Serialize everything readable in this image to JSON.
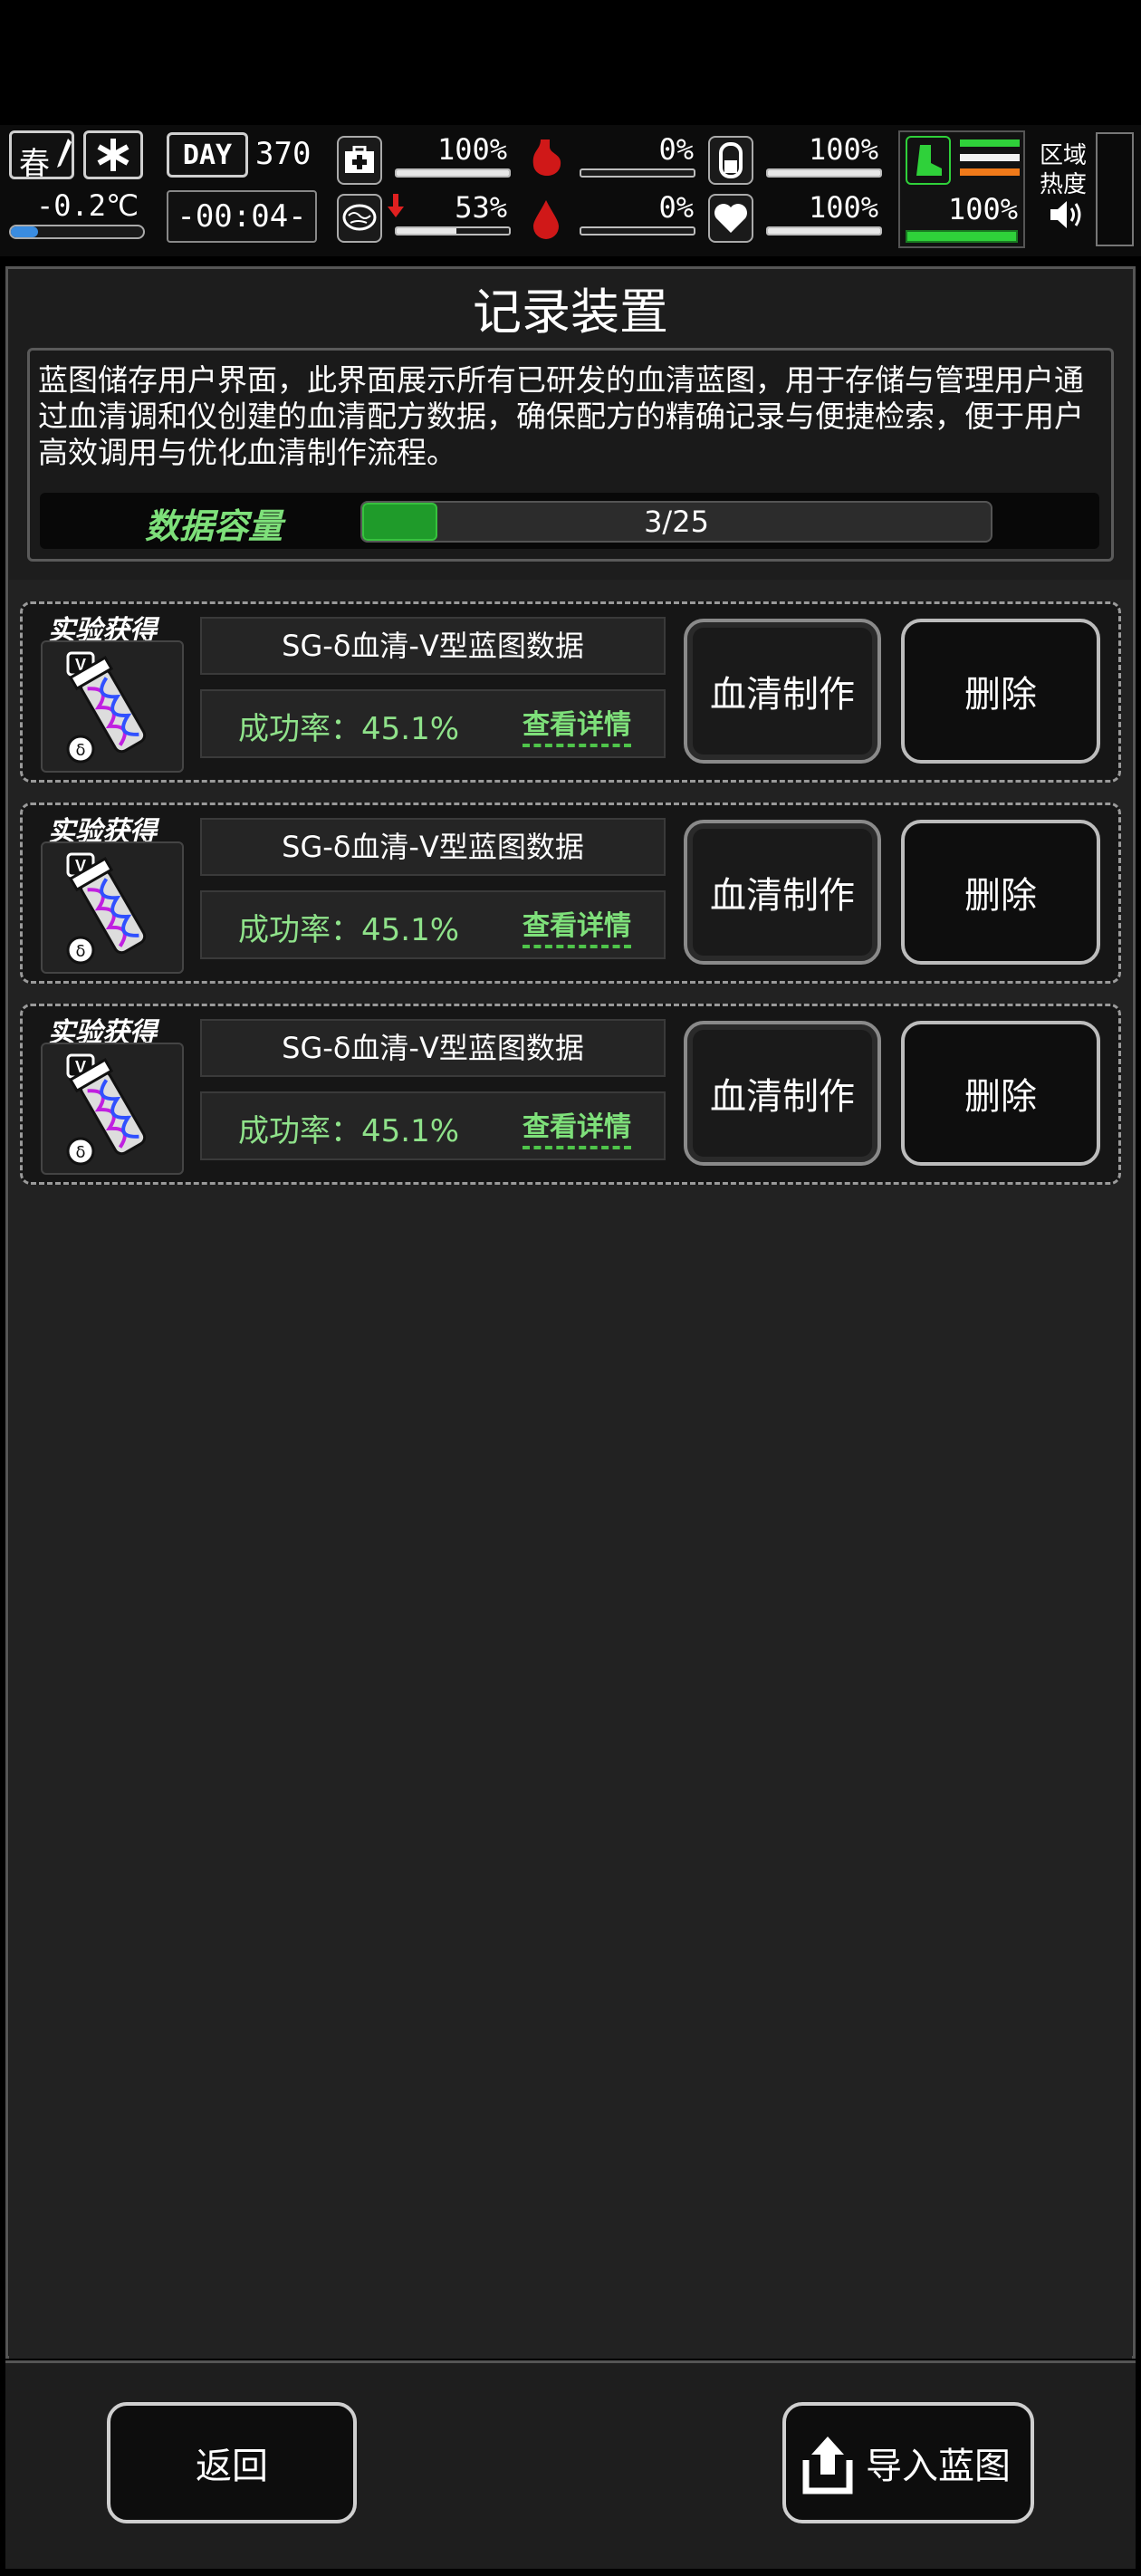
{
  "hud": {
    "season": "春",
    "temperature": "-0.2℃",
    "day_label": "DAY",
    "day_number": "370",
    "clock": "-00:04-",
    "stats": [
      {
        "icon": "medkit-icon",
        "value": "100%",
        "fill": 1.0
      },
      {
        "icon": "stomach-icon",
        "value": "0%",
        "fill": 0.0
      },
      {
        "icon": "bladder-icon",
        "value": "100%",
        "fill": 1.0
      },
      {
        "icon": "brain-icon",
        "value": "53%",
        "fill": 0.53
      },
      {
        "icon": "blood-drop-icon",
        "value": "0%",
        "fill": 0.0
      },
      {
        "icon": "heart-icon",
        "value": "100%",
        "fill": 1.0
      }
    ],
    "stamina_value": "100%",
    "region_label": "区域热度"
  },
  "page": {
    "title": "记录装置",
    "description": "蓝图储存用户界面，此界面展示所有已研发的血清蓝图，用于存储与管理用户通过血清调和仪创建的血清配方数据，确保配方的精确记录与便捷检索，便于用户高效调用与优化血清制作流程。",
    "capacity_label": "数据容量",
    "capacity_text": "3/25",
    "capacity_fraction": 0.12
  },
  "records": [
    {
      "tag": "实验获得",
      "name": "SG-δ血清-V型蓝图数据",
      "rate": "成功率：45.1%",
      "detail": "查看详情",
      "make": "血清制作",
      "delete": "删除",
      "badge": "V"
    },
    {
      "tag": "实验获得",
      "name": "SG-δ血清-V型蓝图数据",
      "rate": "成功率：45.1%",
      "detail": "查看详情",
      "make": "血清制作",
      "delete": "删除",
      "badge": "V"
    },
    {
      "tag": "实验获得",
      "name": "SG-δ血清-V型蓝图数据",
      "rate": "成功率：45.1%",
      "detail": "查看详情",
      "make": "血清制作",
      "delete": "删除",
      "badge": "V"
    }
  ],
  "footer": {
    "back": "返回",
    "import": "导入蓝图"
  },
  "colors": {
    "accent_green": "#7ee07a",
    "stat_red": "#e02020",
    "stamina_green": "#2fd13a"
  }
}
